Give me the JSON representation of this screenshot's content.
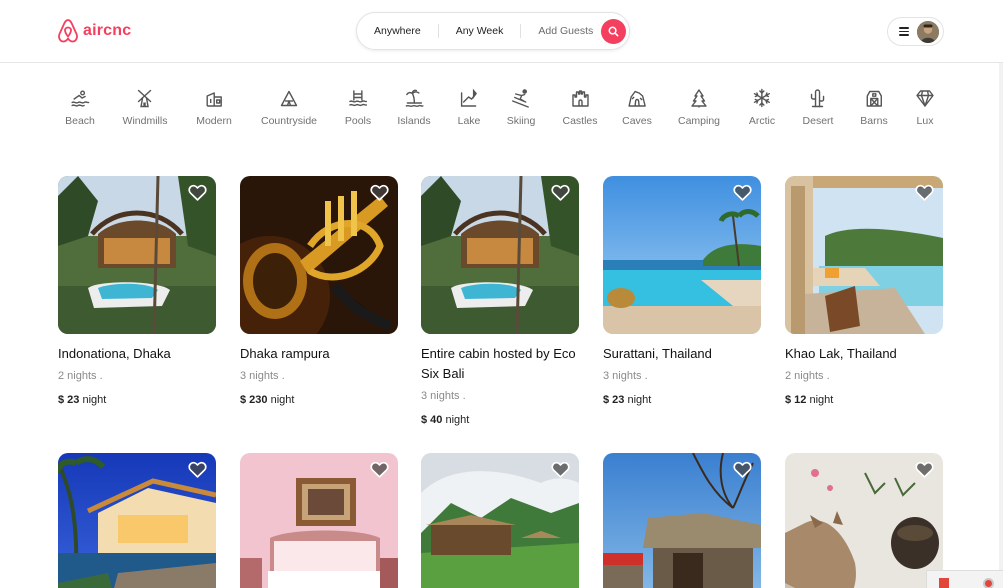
{
  "brand": {
    "name": "aircnc",
    "color": "#f43f5e"
  },
  "search": {
    "where": "Anywhere",
    "when": "Any Week",
    "guests": "Add Guests"
  },
  "categories": [
    {
      "label": "Beach",
      "icon": "beach-icon"
    },
    {
      "label": "Windmills",
      "icon": "windmill-icon"
    },
    {
      "label": "Modern",
      "icon": "modern-house-icon"
    },
    {
      "label": "Countryside",
      "icon": "countryside-icon"
    },
    {
      "label": "Pools",
      "icon": "pool-icon"
    },
    {
      "label": "Islands",
      "icon": "island-icon"
    },
    {
      "label": "Lake",
      "icon": "lake-icon"
    },
    {
      "label": "Skiing",
      "icon": "skiing-icon"
    },
    {
      "label": "Castles",
      "icon": "castle-icon"
    },
    {
      "label": "Caves",
      "icon": "cave-icon"
    },
    {
      "label": "Camping",
      "icon": "camping-icon"
    },
    {
      "label": "Arctic",
      "icon": "snowflake-icon"
    },
    {
      "label": "Desert",
      "icon": "cactus-icon"
    },
    {
      "label": "Barns",
      "icon": "barn-icon"
    },
    {
      "label": "Lux",
      "icon": "diamond-icon"
    }
  ],
  "listings": [
    {
      "title": "Indonationa, Dhaka",
      "nights": "2 nights .",
      "price": "$ 23",
      "unit": "night",
      "photo": "treehouse-pool-photo"
    },
    {
      "title": "Dhaka rampura",
      "nights": "3 nights .",
      "price": "$ 230",
      "unit": "night",
      "photo": "trumpet-photo"
    },
    {
      "title": "Entire cabin hosted by Eco Six Bali",
      "nights": "3 nights .",
      "price": "$ 40",
      "unit": "night",
      "photo": "treehouse-pool-photo"
    },
    {
      "title": "Surattani, Thailand",
      "nights": "3 nights .",
      "price": "$ 23",
      "unit": "night",
      "photo": "infinity-pool-photo"
    },
    {
      "title": "Khao Lak, Thailand",
      "nights": "2 nights .",
      "price": "$ 12",
      "unit": "night",
      "photo": "terrace-pool-photo"
    },
    {
      "photo": "villa-night-photo"
    },
    {
      "photo": "pink-bedroom-photo"
    },
    {
      "photo": "hut-mountain-photo"
    },
    {
      "photo": "thatched-house-photo"
    },
    {
      "photo": "cat-photo"
    }
  ]
}
